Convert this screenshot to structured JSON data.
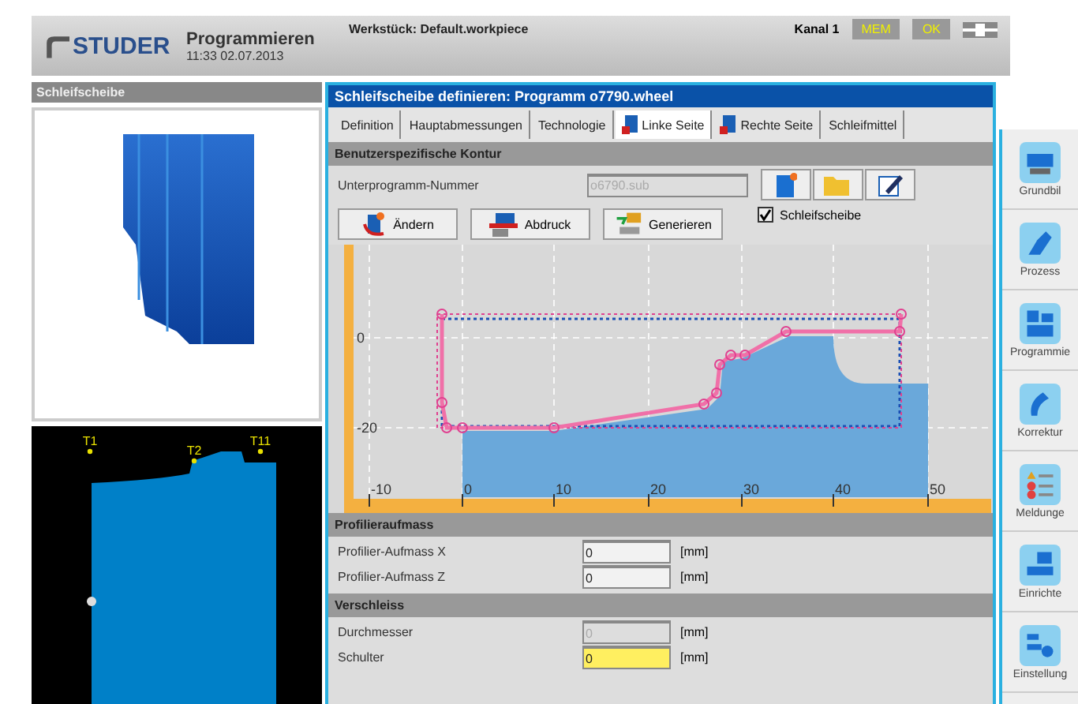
{
  "header": {
    "logo": "STUDER",
    "title": "Programmieren",
    "datetime": "11:33  02.07.2013",
    "workpiece": "Werkstück: Default.workpiece",
    "channel": "Kanal 1",
    "badges": [
      "MEM",
      "OK"
    ]
  },
  "left_panel": {
    "title": "Schleifscheibe",
    "points": [
      "T1",
      "T2",
      "T11"
    ]
  },
  "dialog": {
    "title": "Schleifscheibe definieren: Programm o7790.wheel",
    "tabs": [
      {
        "label": "Definition",
        "selected": false,
        "kind": "plain"
      },
      {
        "label": "Hauptabmessungen",
        "selected": false,
        "kind": "plain"
      },
      {
        "label": "Technologie",
        "selected": false,
        "kind": "plain"
      },
      {
        "label": "Linke Seite",
        "selected": true,
        "kind": "icon"
      },
      {
        "label": "Rechte Seite",
        "selected": false,
        "kind": "icon"
      },
      {
        "label": "Schleifmittel",
        "selected": false,
        "kind": "plain"
      }
    ],
    "contour": {
      "title": "Benutzerspezifische Kontur",
      "subprogram_label": "Unterprogramm-Nummer",
      "subprogram_value": "o6790.sub",
      "buttons": [
        {
          "label": "Ändern",
          "kind": "change"
        },
        {
          "label": "Abdruck",
          "kind": "imprint"
        },
        {
          "label": "Generieren",
          "kind": "generate"
        }
      ],
      "checkbox": {
        "label": "Schleifscheibe",
        "checked": true
      },
      "x_ticks": [
        "-10",
        "0",
        "10",
        "20",
        "30",
        "40",
        "50"
      ],
      "y_ticks": [
        "0",
        "-20"
      ]
    },
    "sections": [
      {
        "title": "Profilieraufmass",
        "fields": [
          {
            "label": "Profilier-Aufmass X",
            "value": "0",
            "unit": "[mm]",
            "disabled": false,
            "highlighted": false
          },
          {
            "label": "Profilier-Aufmass Z",
            "value": "0",
            "unit": "[mm]",
            "disabled": false,
            "highlighted": false
          }
        ]
      },
      {
        "title": "Verschleiss",
        "fields": [
          {
            "label": "Durchmesser",
            "value": "0",
            "unit": "[mm]",
            "disabled": true,
            "highlighted": false
          },
          {
            "label": "Schulter",
            "value": "0",
            "unit": "[mm]",
            "disabled": false,
            "highlighted": true
          }
        ]
      }
    ]
  },
  "nav": [
    {
      "label": "Grundbil",
      "kind": "machine"
    },
    {
      "label": "Prozess",
      "kind": "process"
    },
    {
      "label": "Programmie",
      "kind": "program"
    },
    {
      "label": "Korrektur",
      "kind": "correction"
    },
    {
      "label": "Meldunge",
      "kind": "messages"
    },
    {
      "label": "Einrichte",
      "kind": "setup"
    },
    {
      "label": "Einstellung",
      "kind": "settings"
    }
  ]
}
